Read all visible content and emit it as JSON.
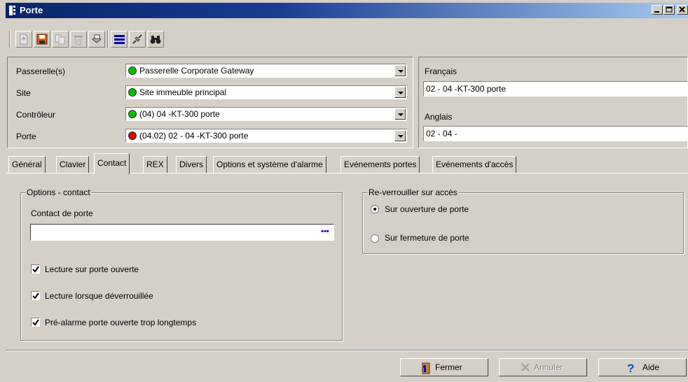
{
  "window": {
    "title": "Porte"
  },
  "toolbar": {
    "buttons": [
      "new-icon",
      "save-icon",
      "copy-icon",
      "delete-icon",
      "print-icon",
      "list-icon",
      "link-icon",
      "find-icon"
    ]
  },
  "selectors": {
    "gateway_label": "Passerelle(s)",
    "gateway_value": "Passerelle Corporate Gateway",
    "site_label": "Site",
    "site_value": "Site immeuble principal",
    "controller_label": "Contrôleur",
    "controller_value": "(04) 04 -KT-300 porte",
    "door_label": "Porte",
    "door_value": "(04.02) 02 - 04 -KT-300 porte",
    "status_colors": {
      "ok": "#00c000",
      "alarm": "#e00000"
    }
  },
  "names": {
    "french_label": "Français",
    "french_value": "02 - 04 -KT-300 porte",
    "english_label": "Anglais",
    "english_value": "02 - 04 -"
  },
  "tabs": [
    {
      "label": "Général"
    },
    {
      "label": "Clavier"
    },
    {
      "label": "Contact"
    },
    {
      "label": "REX"
    },
    {
      "label": "Divers"
    },
    {
      "label": "Options et système d'alarme"
    },
    {
      "label": "Evénements portes"
    },
    {
      "label": "Evénements d'accès"
    }
  ],
  "contact_options": {
    "title": "Options - contact",
    "door_contact_label": "Contact de porte",
    "door_contact_value": "",
    "browse_label": "•••",
    "checks": [
      {
        "label": "Lecture sur porte ouverte",
        "checked": true
      },
      {
        "label": "Lecture lorsque déverrouillée",
        "checked": true
      },
      {
        "label": "Pré-alarme porte ouverte trop longtemps",
        "checked": true
      }
    ]
  },
  "relock": {
    "title": "Re-verrouiller sur accès",
    "options": [
      {
        "label": "Sur ouverture de porte",
        "selected": true
      },
      {
        "label": "Sur fermeture de porte",
        "selected": false
      }
    ]
  },
  "footer": {
    "close_label": "Fermer",
    "cancel_label": "Annuler",
    "help_label": "Aide"
  }
}
